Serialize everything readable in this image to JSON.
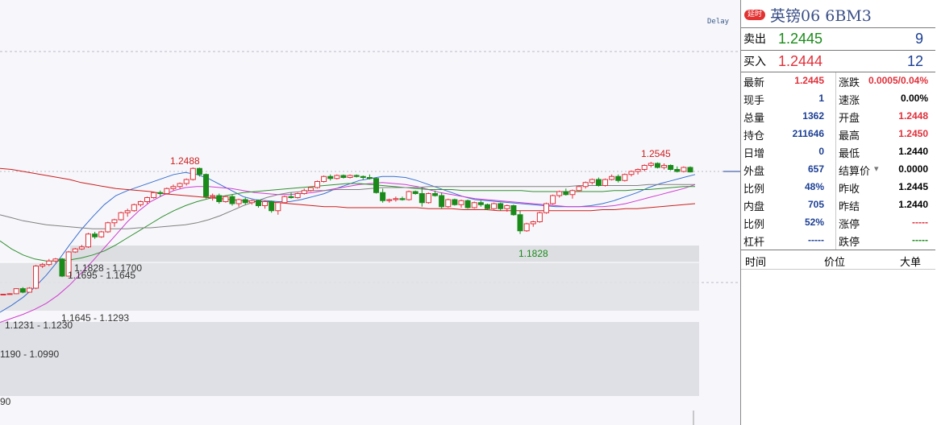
{
  "chart": {
    "delay_label": "Delay",
    "axis_label_bottom": "90",
    "zones": [
      {
        "label": "1.1828 - 1.1700"
      },
      {
        "label": "1.1695 - 1.1645"
      },
      {
        "label": "1.1645 - 1.1293"
      },
      {
        "label": "1.1231 - 1.1230"
      },
      {
        "label": "1190 - 1.0990"
      }
    ],
    "annotations": {
      "high_1": "1.2488",
      "high_2": "1.2545",
      "low_1": "1.1828"
    },
    "colors": {
      "up": "#e0303a",
      "down": "#1a8a1a",
      "ma_red": "#cc1f1f",
      "ma_green": "#2f8f2f",
      "ma_magenta": "#d03cd0",
      "ma_blue": "#3a6fd0",
      "ma_black": "#111111",
      "ma_grey": "#808080"
    }
  },
  "chart_data": {
    "type": "candlestick",
    "title": "英镑06 6BM3",
    "candles": [
      [
        1.1225,
        1.1232,
        1.122,
        1.123
      ],
      [
        1.123,
        1.124,
        1.1225,
        1.1235
      ],
      [
        1.1235,
        1.129,
        1.123,
        1.1285
      ],
      [
        1.1285,
        1.13,
        1.124,
        1.125
      ],
      [
        1.125,
        1.13,
        1.1245,
        1.129
      ],
      [
        1.129,
        1.152,
        1.128,
        1.151
      ],
      [
        1.151,
        1.154,
        1.149,
        1.1525
      ],
      [
        1.1525,
        1.158,
        1.151,
        1.156
      ],
      [
        1.156,
        1.159,
        1.154,
        1.158
      ],
      [
        1.158,
        1.159,
        1.14,
        1.141
      ],
      [
        1.141,
        1.166,
        1.1405,
        1.165
      ],
      [
        1.165,
        1.169,
        1.164,
        1.168
      ],
      [
        1.168,
        1.172,
        1.167,
        1.17
      ],
      [
        1.17,
        1.184,
        1.169,
        1.1828
      ],
      [
        1.1828,
        1.185,
        1.178,
        1.18
      ],
      [
        1.18,
        1.186,
        1.179,
        1.185
      ],
      [
        1.185,
        1.195,
        1.184,
        1.194
      ],
      [
        1.194,
        1.198,
        1.19,
        1.197
      ],
      [
        1.197,
        1.205,
        1.196,
        1.204
      ],
      [
        1.204,
        1.208,
        1.2,
        1.206
      ],
      [
        1.206,
        1.213,
        1.205,
        1.212
      ],
      [
        1.212,
        1.216,
        1.21,
        1.215
      ],
      [
        1.215,
        1.22,
        1.213,
        1.219
      ],
      [
        1.219,
        1.225,
        1.218,
        1.224
      ],
      [
        1.224,
        1.226,
        1.22,
        1.223
      ],
      [
        1.223,
        1.229,
        1.222,
        1.228
      ],
      [
        1.228,
        1.232,
        1.226,
        1.23
      ],
      [
        1.23,
        1.234,
        1.228,
        1.233
      ],
      [
        1.233,
        1.238,
        1.231,
        1.237
      ],
      [
        1.237,
        1.249,
        1.236,
        1.248
      ],
      [
        1.248,
        1.2488,
        1.24,
        1.242
      ],
      [
        1.242,
        1.243,
        1.218,
        1.22
      ],
      [
        1.22,
        1.223,
        1.216,
        1.221
      ],
      [
        1.221,
        1.223,
        1.213,
        1.215
      ],
      [
        1.215,
        1.221,
        1.214,
        1.22
      ],
      [
        1.22,
        1.222,
        1.211,
        1.213
      ],
      [
        1.213,
        1.218,
        1.21,
        1.217
      ],
      [
        1.217,
        1.219,
        1.212,
        1.214
      ],
      [
        1.214,
        1.217,
        1.212,
        1.216
      ],
      [
        1.216,
        1.217,
        1.209,
        1.211
      ],
      [
        1.211,
        1.216,
        1.208,
        1.215
      ],
      [
        1.215,
        1.216,
        1.204,
        1.206
      ],
      [
        1.206,
        1.215,
        1.202,
        1.214
      ],
      [
        1.214,
        1.221,
        1.213,
        1.22
      ],
      [
        1.22,
        1.224,
        1.218,
        1.219
      ],
      [
        1.219,
        1.224,
        1.218,
        1.223
      ],
      [
        1.223,
        1.228,
        1.222,
        1.226
      ],
      [
        1.226,
        1.23,
        1.225,
        1.229
      ],
      [
        1.229,
        1.236,
        1.228,
        1.235
      ],
      [
        1.235,
        1.241,
        1.234,
        1.24
      ],
      [
        1.24,
        1.242,
        1.236,
        1.238
      ],
      [
        1.238,
        1.242,
        1.237,
        1.241
      ],
      [
        1.241,
        1.242,
        1.238,
        1.239
      ],
      [
        1.239,
        1.242,
        1.238,
        1.241
      ],
      [
        1.241,
        1.242,
        1.239,
        1.24
      ],
      [
        1.24,
        1.241,
        1.237,
        1.239
      ],
      [
        1.239,
        1.242,
        1.237,
        1.238
      ],
      [
        1.238,
        1.239,
        1.223,
        1.224
      ],
      [
        1.224,
        1.228,
        1.214,
        1.216
      ],
      [
        1.216,
        1.218,
        1.214,
        1.217
      ],
      [
        1.217,
        1.22,
        1.215,
        1.218
      ],
      [
        1.218,
        1.22,
        1.216,
        1.217
      ],
      [
        1.217,
        1.226,
        1.216,
        1.225
      ],
      [
        1.225,
        1.226,
        1.222,
        1.223
      ],
      [
        1.223,
        1.229,
        1.21,
        1.214
      ],
      [
        1.214,
        1.224,
        1.213,
        1.223
      ],
      [
        1.223,
        1.226,
        1.22,
        1.221
      ],
      [
        1.221,
        1.224,
        1.208,
        1.21
      ],
      [
        1.21,
        1.218,
        1.209,
        1.217
      ],
      [
        1.217,
        1.218,
        1.211,
        1.212
      ],
      [
        1.212,
        1.217,
        1.209,
        1.216
      ],
      [
        1.216,
        1.217,
        1.208,
        1.209
      ],
      [
        1.209,
        1.215,
        1.208,
        1.214
      ],
      [
        1.214,
        1.216,
        1.21,
        1.212
      ],
      [
        1.212,
        1.213,
        1.207,
        1.208
      ],
      [
        1.208,
        1.214,
        1.207,
        1.213
      ],
      [
        1.213,
        1.214,
        1.206,
        1.208
      ],
      [
        1.208,
        1.212,
        1.205,
        1.211
      ],
      [
        1.211,
        1.212,
        1.201,
        1.202
      ],
      [
        1.202,
        1.206,
        1.1828,
        1.186
      ],
      [
        1.186,
        1.194,
        1.185,
        1.193
      ],
      [
        1.193,
        1.196,
        1.19,
        1.195
      ],
      [
        1.195,
        1.205,
        1.194,
        1.204
      ],
      [
        1.204,
        1.214,
        1.203,
        1.213
      ],
      [
        1.213,
        1.222,
        1.212,
        1.221
      ],
      [
        1.221,
        1.226,
        1.219,
        1.225
      ],
      [
        1.225,
        1.228,
        1.221,
        1.222
      ],
      [
        1.222,
        1.227,
        1.218,
        1.226
      ],
      [
        1.226,
        1.231,
        1.225,
        1.23
      ],
      [
        1.23,
        1.235,
        1.228,
        1.234
      ],
      [
        1.234,
        1.238,
        1.232,
        1.237
      ],
      [
        1.237,
        1.239,
        1.23,
        1.231
      ],
      [
        1.231,
        1.238,
        1.23,
        1.237
      ],
      [
        1.237,
        1.242,
        1.236,
        1.24
      ],
      [
        1.24,
        1.242,
        1.234,
        1.236
      ],
      [
        1.236,
        1.243,
        1.235,
        1.242
      ],
      [
        1.242,
        1.246,
        1.24,
        1.245
      ],
      [
        1.245,
        1.248,
        1.242,
        1.247
      ],
      [
        1.247,
        1.252,
        1.245,
        1.251
      ],
      [
        1.251,
        1.2545,
        1.249,
        1.253
      ],
      [
        1.253,
        1.254,
        1.248,
        1.249
      ],
      [
        1.249,
        1.253,
        1.247,
        1.251
      ],
      [
        1.251,
        1.252,
        1.246,
        1.247
      ],
      [
        1.247,
        1.25,
        1.244,
        1.245
      ],
      [
        1.245,
        1.25,
        1.244,
        1.249
      ],
      [
        1.249,
        1.25,
        1.244,
        1.2445
      ]
    ],
    "ma": [
      {
        "name": "MA-blue",
        "color": "#3a6fd0",
        "values": [
          1.105,
          1.112,
          1.12,
          1.13,
          1.142,
          1.156,
          1.172,
          1.187,
          1.2,
          1.212,
          1.221,
          1.226,
          1.23,
          1.234,
          1.238,
          1.242,
          1.244,
          1.242,
          1.238,
          1.232,
          1.226,
          1.22,
          1.217,
          1.216,
          1.215,
          1.215,
          1.217,
          1.22,
          1.223,
          1.228,
          1.232,
          1.236,
          1.238,
          1.24,
          1.24,
          1.239,
          1.236,
          1.232,
          1.228,
          1.224,
          1.22,
          1.217,
          1.216,
          1.215,
          1.214,
          1.213,
          1.212,
          1.211,
          1.21,
          1.21,
          1.21,
          1.211,
          1.213,
          1.216,
          1.22,
          1.224,
          1.229,
          1.233,
          1.236,
          1.239,
          1.242
        ]
      },
      {
        "name": "MA-magenta",
        "color": "#d03cd0",
        "values": [
          1.095,
          1.099,
          1.103,
          1.108,
          1.114,
          1.122,
          1.132,
          1.144,
          1.156,
          1.169,
          1.182,
          1.195,
          1.206,
          1.215,
          1.221,
          1.226,
          1.229,
          1.23,
          1.23,
          1.229,
          1.228,
          1.226,
          1.224,
          1.223,
          1.222,
          1.222,
          1.223,
          1.224,
          1.226,
          1.228,
          1.23,
          1.232,
          1.233,
          1.234,
          1.233,
          1.232,
          1.23,
          1.227,
          1.224,
          1.222,
          1.22,
          1.218,
          1.217,
          1.216,
          1.215,
          1.214,
          1.213,
          1.212,
          1.211,
          1.21,
          1.21,
          1.21,
          1.21,
          1.211,
          1.213,
          1.216,
          1.219,
          1.222,
          1.225,
          1.228,
          1.232
        ]
      },
      {
        "name": "MA-green",
        "color": "#2f8f2f",
        "values": [
          1.176,
          1.168,
          1.162,
          1.158,
          1.156,
          1.156,
          1.157,
          1.159,
          1.162,
          1.166,
          1.172,
          1.179,
          1.186,
          1.193,
          1.2,
          1.206,
          1.211,
          1.215,
          1.218,
          1.22,
          1.222,
          1.224,
          1.225,
          1.226,
          1.227,
          1.228,
          1.229,
          1.23,
          1.231,
          1.232,
          1.233,
          1.233,
          1.232,
          1.231,
          1.23,
          1.229,
          1.228,
          1.227,
          1.227,
          1.227,
          1.226,
          1.226,
          1.226,
          1.226,
          1.226,
          1.226,
          1.225,
          1.225,
          1.225,
          1.225,
          1.225,
          1.225,
          1.225,
          1.226,
          1.226,
          1.227,
          1.227,
          1.228,
          1.229,
          1.23,
          1.23
        ]
      },
      {
        "name": "MA-grey",
        "color": "#808080",
        "values": [
          1.202,
          1.199,
          1.196,
          1.194,
          1.192,
          1.191,
          1.19,
          1.189,
          1.188,
          1.188,
          1.188,
          1.188,
          1.189,
          1.189,
          1.19,
          1.191,
          1.192,
          1.194,
          1.197,
          1.201,
          1.206,
          1.211,
          1.215,
          1.219,
          1.222,
          1.224,
          1.225,
          1.226,
          1.226,
          1.227,
          1.227,
          1.227,
          1.228,
          1.229,
          1.229,
          1.229,
          1.229,
          1.23,
          1.23,
          1.23,
          1.23,
          1.23,
          1.23,
          1.23,
          1.23,
          1.23,
          1.23,
          1.23,
          1.23,
          1.23,
          1.231,
          1.231,
          1.231,
          1.231,
          1.231,
          1.231,
          1.232,
          1.232,
          1.232,
          1.232,
          1.232
        ]
      },
      {
        "name": "MA-red",
        "color": "#cc1f1f",
        "values": [
          1.248,
          1.247,
          1.245,
          1.243,
          1.241,
          1.239,
          1.237,
          1.234,
          1.232,
          1.23,
          1.228,
          1.227,
          1.226,
          1.225,
          1.223,
          1.222,
          1.221,
          1.22,
          1.219,
          1.218,
          1.217,
          1.216,
          1.215,
          1.215,
          1.214,
          1.213,
          1.212,
          1.211,
          1.21,
          1.21,
          1.209,
          1.209,
          1.209,
          1.209,
          1.209,
          1.209,
          1.209,
          1.208,
          1.208,
          1.208,
          1.207,
          1.207,
          1.207,
          1.206,
          1.206,
          1.206,
          1.206,
          1.206,
          1.206,
          1.206,
          1.206,
          1.206,
          1.207,
          1.207,
          1.208,
          1.208,
          1.209,
          1.21,
          1.211,
          1.212,
          1.213
        ]
      }
    ]
  },
  "quote": {
    "badge": "延时",
    "title": "英镑06  6BM3",
    "ask_label": "卖出",
    "ask_price": "1.2445",
    "ask_vol": "9",
    "bid_label": "买入",
    "bid_price": "1.2444",
    "bid_vol": "12",
    "rows": [
      {
        "l1": "最新",
        "v1": "1.2445",
        "c1": "#e0303a",
        "l2": "涨跌",
        "v2": "0.0005/0.04%",
        "c2": "#e0303a"
      },
      {
        "l1": "现手",
        "v1": "1",
        "c1": "#1c3f94",
        "l2": "速涨",
        "v2": "0.00%",
        "c2": "#000000"
      },
      {
        "l1": "总量",
        "v1": "1362",
        "c1": "#1c3f94",
        "l2": "开盘",
        "v2": "1.2448",
        "c2": "#e0303a"
      },
      {
        "l1": "持仓",
        "v1": "211646",
        "c1": "#1c3f94",
        "l2": "最高",
        "v2": "1.2450",
        "c2": "#e0303a"
      },
      {
        "l1": "日增",
        "v1": "0",
        "c1": "#1c3f94",
        "l2": "最低",
        "v2": "1.2440",
        "c2": "#000000"
      },
      {
        "l1": "外盘",
        "v1": "657",
        "c1": "#1c3f94",
        "l2": "结算价",
        "v2": "0.0000",
        "c2": "#000000"
      },
      {
        "l1": "比例",
        "v1": "48%",
        "c1": "#1c3f94",
        "l2": "昨收",
        "v2": "1.2445",
        "c2": "#000000"
      },
      {
        "l1": "内盘",
        "v1": "705",
        "c1": "#1c3f94",
        "l2": "昨结",
        "v2": "1.2440",
        "c2": "#000000"
      },
      {
        "l1": "比例",
        "v1": "52%",
        "c1": "#1c3f94",
        "l2": "涨停",
        "v2": "-----",
        "c2": "#e0303a"
      },
      {
        "l1": "杠杆",
        "v1": "-----",
        "c1": "#1c3f94",
        "l2": "跌停",
        "v2": "-----",
        "c2": "#1a8a1a"
      }
    ],
    "trades_header": {
      "time": "时间",
      "price": "价位",
      "big": "大单"
    }
  }
}
